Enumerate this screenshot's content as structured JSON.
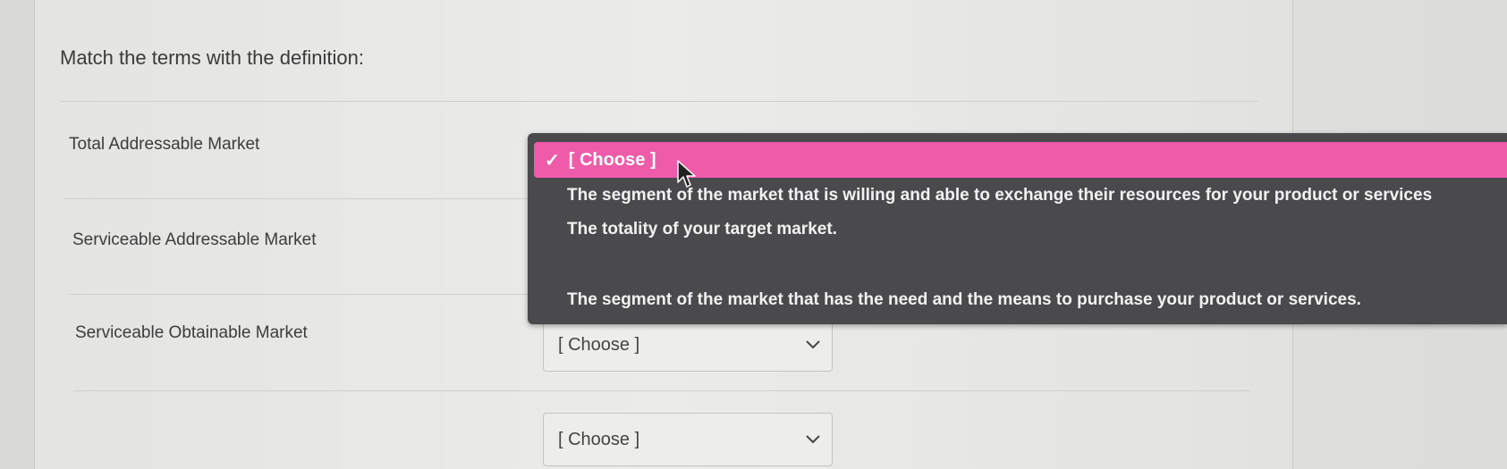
{
  "question": {
    "prompt": "Match the terms with the definition:"
  },
  "terms": [
    "Total Addressable Market",
    "Serviceable Addressable Market",
    "Serviceable Obtainable Market"
  ],
  "selects": [
    {
      "value": "[ Choose ]"
    },
    {
      "value": "[ Choose ]"
    }
  ],
  "dropdown": {
    "selected_label": "[ Choose ]",
    "check_glyph": "✓",
    "options": [
      "The segment of the market that is willing and able to exchange their resources for your product or services",
      "The totality of your target market.",
      "The segment of the market that has the need and the means to purchase your product or services."
    ]
  },
  "colors": {
    "highlight": "#ee5ba8",
    "dropdown_bg": "#4a4a4c"
  },
  "icons": {
    "chevron": "chevron-down-icon",
    "check": "check-icon",
    "cursor": "mouse-pointer-icon"
  }
}
